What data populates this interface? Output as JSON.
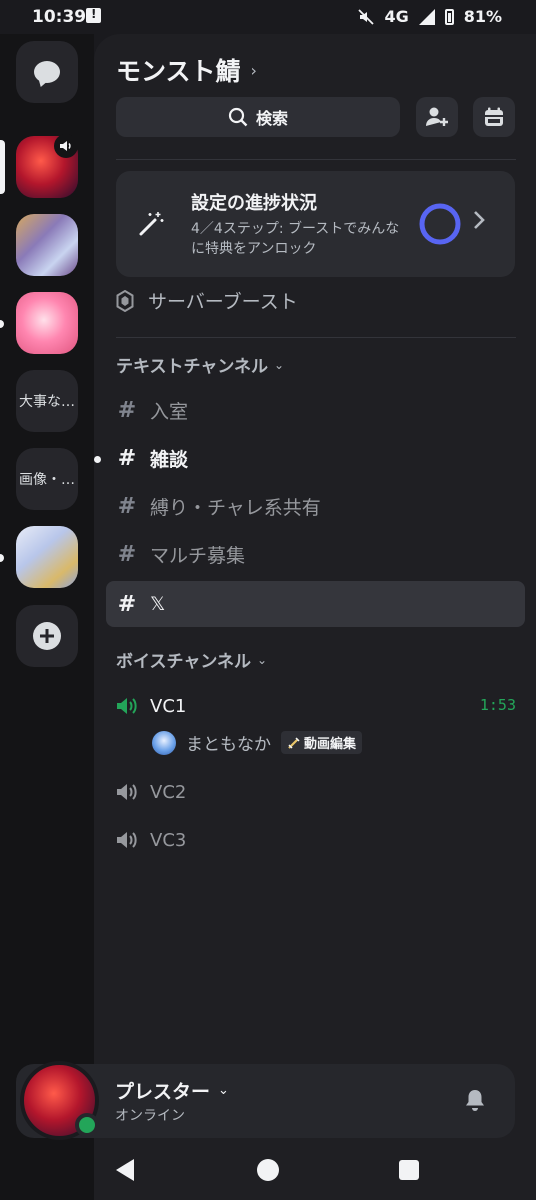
{
  "status_bar": {
    "time": "10:39",
    "network": "4G",
    "battery": "81%"
  },
  "server": {
    "name": "モンスト鯖",
    "search_label": "検索"
  },
  "rail": {
    "text_servers": [
      {
        "label": "大事な…"
      },
      {
        "label": "画像・…"
      }
    ]
  },
  "progress": {
    "title": "設定の進捗状況",
    "subtitle": "4／4ステップ: ブーストでみんなに特典をアンロック",
    "completed_steps": 4,
    "total_steps": 4
  },
  "boost_label": "サーバーブースト",
  "text_category": "テキストチャンネル",
  "text_channels": [
    {
      "name": "入室"
    },
    {
      "name": "雑談"
    },
    {
      "name": "縛り・チャレ系共有"
    },
    {
      "name": "マルチ募集"
    },
    {
      "name": "𝕏"
    }
  ],
  "voice_category": "ボイスチャンネル",
  "voice_channels": [
    {
      "name": "VC1",
      "timer": "1:53"
    },
    {
      "name": "VC2"
    },
    {
      "name": "VC3"
    }
  ],
  "vc_member": {
    "name": "まともなか",
    "role": "動画編集"
  },
  "user": {
    "name": "プレスター",
    "status": "オンライン"
  },
  "colors": {
    "accent": "#5865f2",
    "online": "#23a559",
    "panel": "#1f1f23",
    "rail": "#141416"
  }
}
